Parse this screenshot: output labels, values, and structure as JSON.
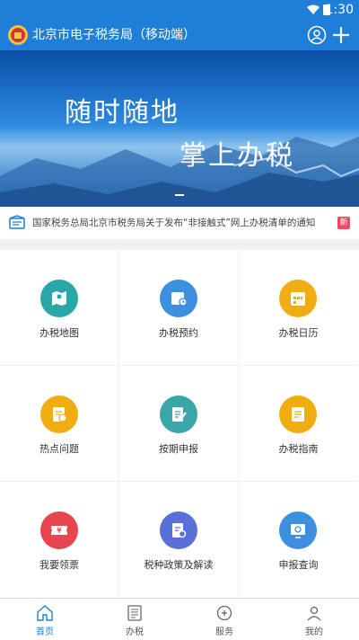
{
  "status": {
    "time": "1:30"
  },
  "app": {
    "title": "北京市电子税务局（移动端）"
  },
  "banner": {
    "line1": "随时随地",
    "line2": "掌上办税"
  },
  "notice": {
    "text": "国家税务总局北京市税务局关于发布“非接触式”网上办税清单的通知",
    "badge": "新"
  },
  "grid": [
    {
      "label": "办税地图",
      "color": "#2aa8a8",
      "icon": "map-icon"
    },
    {
      "label": "办税预约",
      "color": "#3d8fe0",
      "icon": "appointment-icon"
    },
    {
      "label": "办税日历",
      "color": "#f0ad12",
      "icon": "calendar-icon"
    },
    {
      "label": "热点问题",
      "color": "#f0ad12",
      "icon": "faq-icon"
    },
    {
      "label": "按期申报",
      "color": "#3aa6a8",
      "icon": "declare-icon"
    },
    {
      "label": "办税指南",
      "color": "#f0ad12",
      "icon": "guide-icon"
    },
    {
      "label": "我要领票",
      "color": "#e8464e",
      "icon": "ticket-icon"
    },
    {
      "label": "税种政策及解读",
      "color": "#5870d8",
      "icon": "policy-icon"
    },
    {
      "label": "申报查询",
      "color": "#3d8fe0",
      "icon": "query-icon"
    }
  ],
  "tabs": [
    {
      "label": "首页",
      "icon": "home-icon"
    },
    {
      "label": "办税",
      "icon": "tax-icon"
    },
    {
      "label": "服务",
      "icon": "service-icon"
    },
    {
      "label": "我的",
      "icon": "profile-icon"
    }
  ]
}
